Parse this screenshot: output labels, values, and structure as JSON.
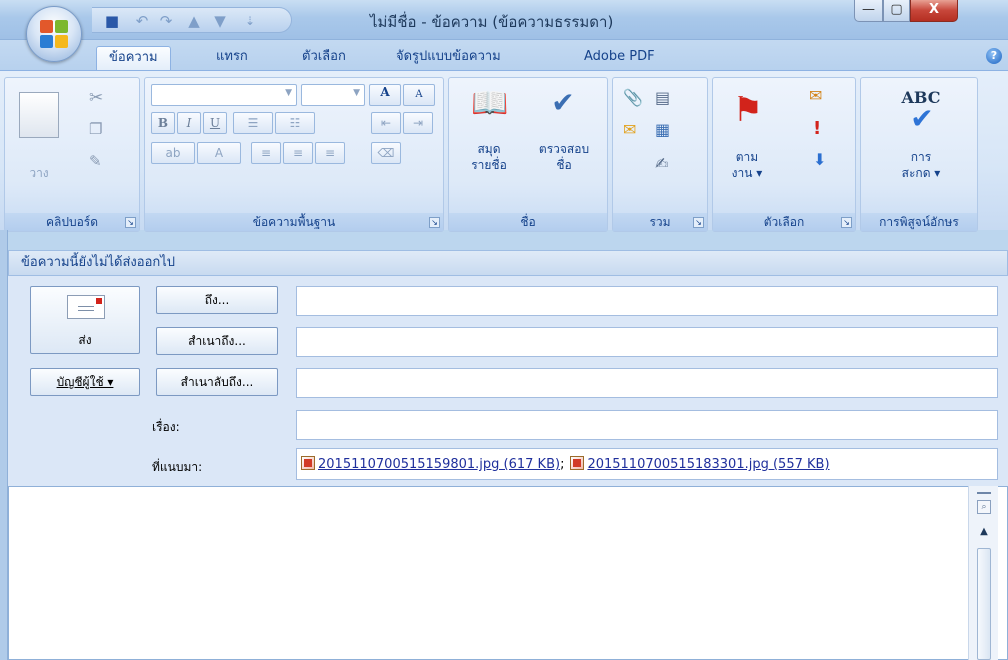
{
  "window": {
    "title": "ไม่มีชื่อ - ข้อความ (ข้อความธรรมดา)",
    "minimize_glyph": "—",
    "maximize_glyph": "▢",
    "close_glyph": "X"
  },
  "help_glyph": "?",
  "tabs": [
    {
      "label": "ข้อความ",
      "active": true
    },
    {
      "label": "แทรก",
      "active": false
    },
    {
      "label": "ตัวเลือก",
      "active": false
    },
    {
      "label": "จัดรูปแบบข้อความ",
      "active": false
    },
    {
      "label": "Adobe PDF",
      "active": false
    }
  ],
  "ribbon": {
    "clipboard": {
      "label": "คลิปบอร์ด",
      "paste_label": "วาง"
    },
    "basic_text": {
      "label": "ข้อความพื้นฐาน",
      "bold": "B",
      "italic": "I",
      "underline": "U",
      "grow": "A",
      "shrink": "A",
      "font_color": "A"
    },
    "names": {
      "label": "ชื่อ",
      "address_book_line1": "สมุด",
      "address_book_line2": "รายชื่อ",
      "check_names_line1": "ตรวจสอบ",
      "check_names_line2": "ชื่อ"
    },
    "include": {
      "label": "รวม"
    },
    "options": {
      "label": "ตัวเลือก",
      "follow_up_line1": "ตาม",
      "follow_up_line2": "งาน ▾"
    },
    "proofing": {
      "label": "การพิสูจน์อักษร",
      "spelling_line1": "การ",
      "spelling_line2": "สะกด ▾",
      "abc": "ABC"
    }
  },
  "infobar": "ข้อความนี้ยังไม่ได้ส่งออกไป",
  "compose": {
    "send_label": "ส่ง",
    "account_label": "บัญชีผู้ใช้ ▾",
    "to_button": "ถึง...",
    "cc_button": "สำเนาถึง...",
    "bcc_button": "สำเนาลับถึง...",
    "subject_label": "เรื่อง:",
    "attached_label": "ที่แนบมา:",
    "to_value": "",
    "cc_value": "",
    "bcc_value": "",
    "subject_value": "",
    "attachments": [
      {
        "name": "201511070051515980​1.jpg",
        "display": "2015110700515159801.jpg (617 KB)"
      },
      {
        "name": "2015110700515183301.jpg",
        "display": "2015110700515183301.jpg (557 KB)"
      }
    ],
    "attachment_separator": ";"
  },
  "scroll": {
    "up_glyph": "▲"
  }
}
